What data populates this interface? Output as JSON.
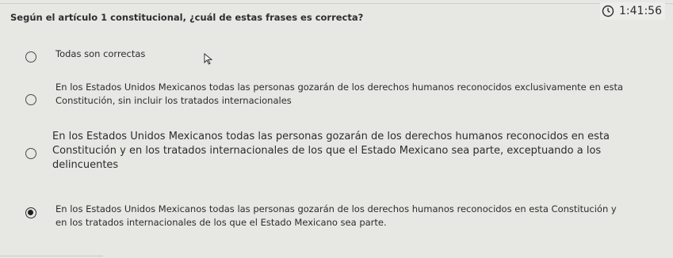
{
  "timer": {
    "icon": "clock-icon",
    "time": "1:41:56"
  },
  "question": "Según el artículo 1 constitucional, ¿cuál de estas frases es correcta?",
  "options": [
    {
      "label": "Todas son correctas",
      "selected": false
    },
    {
      "label": "En los Estados Unidos Mexicanos todas las personas gozarán de los derechos humanos reconocidos exclusivamente en esta\nConstitución, sin incluir los tratados internacionales",
      "selected": false
    },
    {
      "label": "En los Estados Unidos Mexicanos todas las personas gozarán de los derechos humanos reconocidos en esta\nConstitución y en los tratados internacionales de los que el Estado Mexicano sea parte, exceptuando a los\ndelincuentes",
      "selected": false
    },
    {
      "label": "En los Estados Unidos Mexicanos todas las personas gozarán de los derechos humanos reconocidos en esta Constitución y\nen los tratados internacionales de los que el Estado Mexicano sea parte.",
      "selected": true
    }
  ],
  "colors": {
    "background": "#e7e7e4",
    "text": "#2c2c2c",
    "radio_border": "#4b4b4b"
  }
}
